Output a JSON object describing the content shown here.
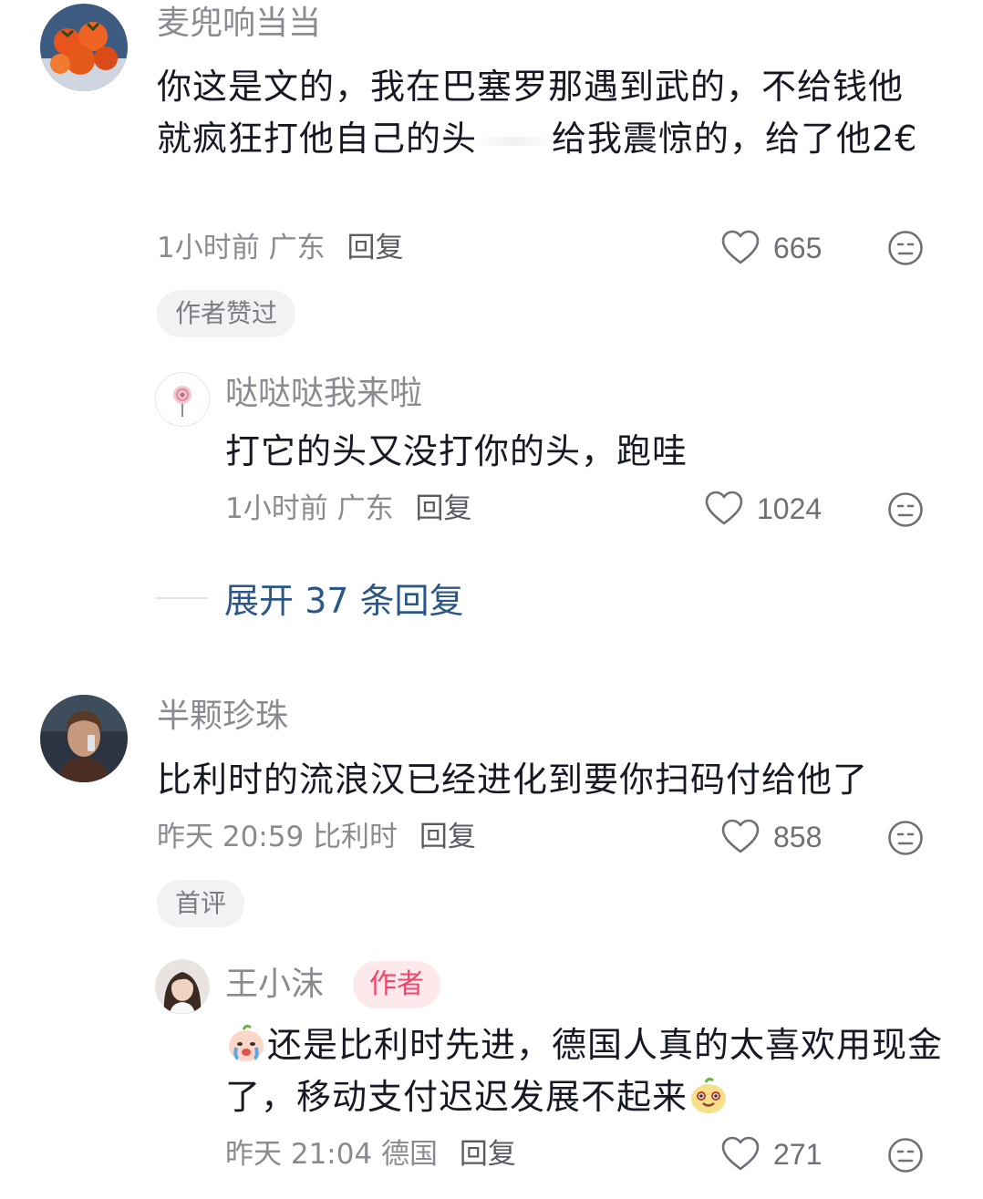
{
  "comments": [
    {
      "username": "麦兜响当当",
      "text_parts": [
        "你这是文的，我在巴塞罗那遇到武的，不给钱他就疯狂打他自己的头",
        "给我震惊的，给了他2€"
      ],
      "time": "1小时前",
      "location": "广东",
      "reply_label": "回复",
      "likes": "665",
      "tag": "作者赞过",
      "replies": [
        {
          "username": "哒哒哒我来啦",
          "text": "打它的头又没打你的头，跑哇",
          "time": "1小时前",
          "location": "广东",
          "reply_label": "回复",
          "likes": "1024"
        }
      ],
      "expand_label": "展开 37 条回复"
    },
    {
      "username": "半颗珍珠",
      "text": "比利时的流浪汉已经进化到要你扫码付给他了",
      "time": "昨天 20:59",
      "location": "比利时",
      "reply_label": "回复",
      "likes": "858",
      "tag": "首评",
      "replies": [
        {
          "username": "王小沫",
          "badge": "作者",
          "text_parts": [
            "还是比利时先进，德国人真的太喜欢用现金了，移动支付迟迟发展不起来"
          ],
          "emojis": [
            "crying-emoji",
            "smiling-emoji"
          ],
          "time": "昨天 21:04",
          "location": "德国",
          "reply_label": "回复",
          "likes": "271"
        }
      ]
    }
  ],
  "colors": {
    "username": "#8a8b91",
    "text": "#161823",
    "expand": "#2a5788",
    "author_badge_bg": "#fde8ec",
    "author_badge_text": "#f2446b"
  }
}
